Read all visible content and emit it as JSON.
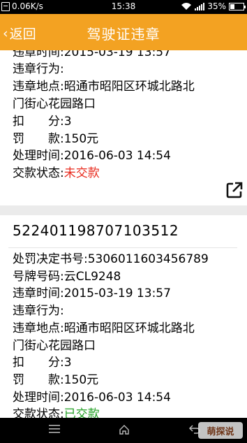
{
  "status_bar": {
    "speed": "0.06K/s",
    "time": "15:38",
    "battery": "35%",
    "battery_level": 0.35
  },
  "header": {
    "back_label": "返回",
    "title": "驾驶证违章"
  },
  "record1": {
    "time_label": "违章时间:",
    "time_value": "2015-03-19 13:57",
    "behavior_label": "违章行为:",
    "location_label": "违章地点:",
    "location_value_line1": "昭通市昭阳区环城北路北",
    "location_value_line2": "门街心花园路口",
    "points_label": "扣　　分:",
    "points_value": "3",
    "fine_label": "罚　　款:",
    "fine_value": "150元",
    "process_label": "处理时间:",
    "process_value": "2016-06-03 14:54",
    "payment_label": "交款状态:",
    "payment_value": "未交款"
  },
  "record2": {
    "id": "522401198707103512",
    "decision_label": "处罚决定书号:",
    "decision_value": "5306011603456789",
    "plate_label": "号牌号码:",
    "plate_value": "云CL9248",
    "time_label": "违章时间:",
    "time_value": "2015-03-19 13:57",
    "behavior_label": "违章行为:",
    "location_label": "违章地点:",
    "location_value_line1": "昭通市昭阳区环城北路北",
    "location_value_line2": "门街心花园路口",
    "points_label": "扣　　分:",
    "points_value": "3",
    "fine_label": "罚　　款:",
    "fine_value": "150元",
    "process_label": "处理时间:",
    "process_value": "2016-06-03 14:54",
    "payment_label": "交款状态:",
    "payment_value": "已交款"
  },
  "watermark": "萌探说",
  "colors": {
    "header": "#f3a222",
    "unpaid": "#e8291c",
    "paid": "#22a024"
  },
  "icons": {
    "share": "external-link-icon",
    "nav_menu": "menu-icon",
    "nav_home": "home-icon",
    "nav_back": "back-icon"
  }
}
